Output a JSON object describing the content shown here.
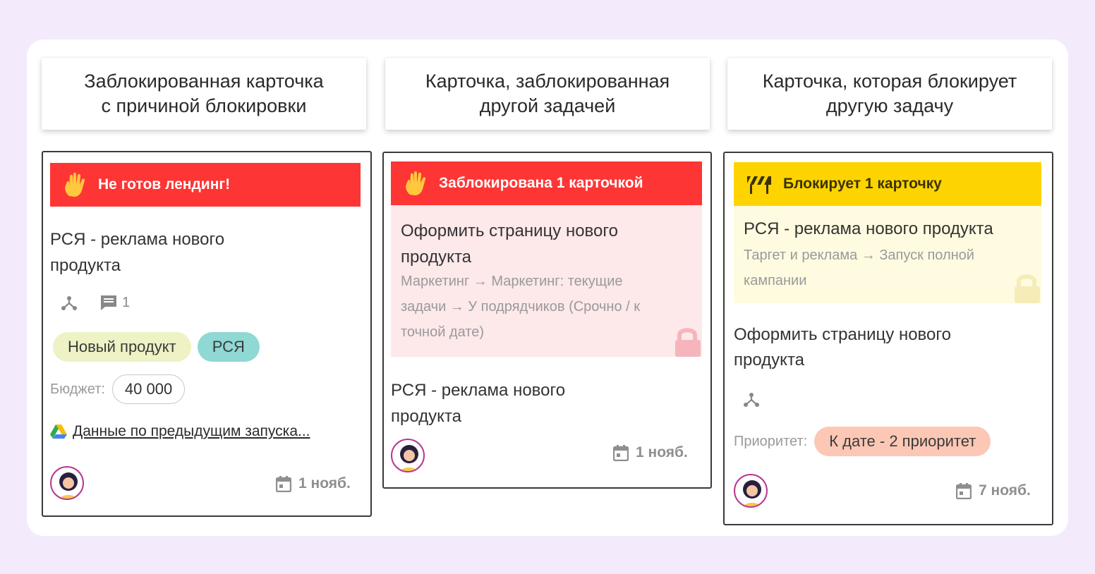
{
  "columns": [
    {
      "header": [
        "Заблокированная карточка",
        "с причиной блокировки"
      ],
      "card": {
        "banner": "Не готов лендинг!",
        "title": [
          "РСЯ - реклама нового",
          "продукта"
        ],
        "comments_count": "1",
        "tags": [
          {
            "label": "Новый продукт",
            "color": "#eef2c4"
          },
          {
            "label": "РСЯ",
            "color": "#8fd8d4"
          }
        ],
        "field_label": "Бюджет:",
        "field_value": "40 000",
        "link": "Данные по предыдущим запуска...",
        "date": "1 нояб."
      }
    },
    {
      "header": [
        "Карточка, заблокированная",
        "другой задачей"
      ],
      "card": {
        "banner": "Заблокирована 1 карточкой",
        "blocker_title": [
          "Оформить страницу нового",
          "продукта"
        ],
        "blocker_path": [
          "Маркетинг → Маркетинг: текущие",
          "задачи → У подрядчиков (Срочно / к",
          "точной дате)"
        ],
        "title": [
          "РСЯ - реклама нового",
          "продукта"
        ],
        "date": "1 нояб."
      }
    },
    {
      "header": [
        "Карточка, которая блокирует",
        "другую задачу"
      ],
      "card": {
        "banner": "Блокирует 1 карточку",
        "blocked_title": "РСЯ - реклама нового продукта",
        "blocked_path": [
          "Таргет и реклама → Запуск полной",
          "кампании"
        ],
        "title": [
          "Оформить страницу нового",
          "продукта"
        ],
        "field_label": "Приоритет:",
        "field_value": "К дате - 2 приоритет",
        "date": "7 нояб."
      }
    }
  ],
  "colors": {
    "page_bg": "#f3eafc",
    "red_banner": "#fe3535",
    "yellow_banner": "#fdd400",
    "blocker_bg": "#fde8ea",
    "blocked_bg": "#fefbe0",
    "priority_pill": "#fcc7b5"
  },
  "icons": [
    "hand-icon",
    "barrier-icon",
    "subtask-icon",
    "comment-icon",
    "calendar-icon",
    "gdrive-icon",
    "lock-icon",
    "avatar"
  ]
}
